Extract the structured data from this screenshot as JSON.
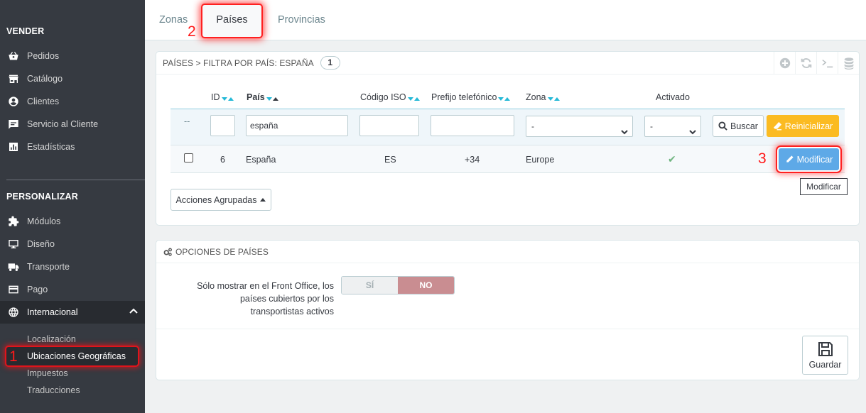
{
  "sidebar": {
    "sections": [
      "VENDER",
      "PERSONALIZAR"
    ],
    "sell_items": [
      {
        "label": "Pedidos",
        "icon": "shopping-basket-icon"
      },
      {
        "label": "Catálogo",
        "icon": "store-icon"
      },
      {
        "label": "Clientes",
        "icon": "account-circle-icon"
      },
      {
        "label": "Servicio al Cliente",
        "icon": "chat-icon"
      },
      {
        "label": "Estadísticas",
        "icon": "bar-chart-icon"
      }
    ],
    "custom_items": [
      {
        "label": "Módulos",
        "icon": "puzzle-icon"
      },
      {
        "label": "Diseño",
        "icon": "desktop-icon"
      },
      {
        "label": "Transporte",
        "icon": "truck-icon"
      },
      {
        "label": "Pago",
        "icon": "credit-card-icon"
      },
      {
        "label": "Internacional",
        "icon": "globe-icon"
      }
    ],
    "sub_items": [
      "Localización",
      "Ubicaciones Geográficas",
      "Impuestos",
      "Traducciones"
    ]
  },
  "markers": [
    "1",
    "2",
    "3"
  ],
  "tabs": [
    "Zonas",
    "Países",
    "Provincias"
  ],
  "list_panel": {
    "title": "PAÍSES > FILTRA POR PAÍS: ESPAÑA",
    "count": "1",
    "columns": [
      "ID",
      "País",
      "Código ISO",
      "Prefijo telefónico",
      "Zona",
      "Activado"
    ],
    "filter": {
      "id_value": "",
      "country_value": "españa",
      "iso_value": "",
      "prefix_value": "",
      "zone_selected": "-",
      "active_selected": "-",
      "dash": "--"
    },
    "search_label": "Buscar",
    "reset_label": "Reinicializar",
    "row": {
      "id": "6",
      "country": "España",
      "iso": "ES",
      "prefix": "+34",
      "zone": "Europe",
      "active": "✔"
    },
    "edit_label": "Modificar",
    "tooltip": "Modificar",
    "bulk_label": "Acciones Agrupadas"
  },
  "options_panel": {
    "title": "OPCIONES DE PAÍSES",
    "label_lines": [
      "Sólo mostrar en el Front Office, los",
      "países cubiertos por los",
      "transportistas activos"
    ],
    "yes": "SÍ",
    "no": "NO",
    "save_label": "Guardar"
  },
  "colors": {
    "sidebar_bg": "#363a41",
    "accent": "#25b9d7",
    "reset_btn": "#fbbb22",
    "edit_btn": "#5ea9e7",
    "toggle_no": "#c98d91",
    "check_green": "#70b580",
    "highlight": "#ff2020"
  }
}
